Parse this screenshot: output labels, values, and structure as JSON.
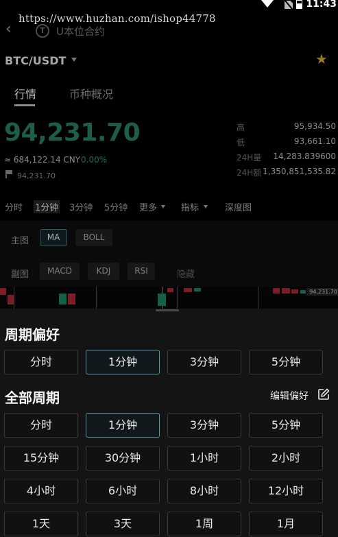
{
  "status_bar": {
    "time": "11:43",
    "icons": [
      "signal-icon",
      "sim-icon",
      "battery-icon"
    ]
  },
  "watermark": "https://www.huzhan.com/ishop44778",
  "header": {
    "back_icon": "chevron-left-icon",
    "coin_badge": "T",
    "breadcrumb": "U本位合约"
  },
  "pair": {
    "symbol": "BTC/USDT",
    "favorite_color": "#9a7b25"
  },
  "tabs": [
    {
      "label": "行情",
      "active": true
    },
    {
      "label": "币种概况",
      "active": false
    }
  ],
  "ticker": {
    "last_price": "94,231.70",
    "cny_value": "≈ 684,122.14 CNY",
    "change_pct": "0.00%",
    "mark_price": "94,231.70",
    "price_color": "#1c5e48"
  },
  "stats": [
    {
      "label": "高",
      "value": "95,934.50"
    },
    {
      "label": "低",
      "value": "93,661.10"
    },
    {
      "label": "24H量",
      "value": "14,283.839600"
    },
    {
      "label": "24H额",
      "value": "1,350,851,535.82"
    }
  ],
  "chart_toolbar": {
    "periods": [
      "分时",
      "1分钟",
      "3分钟",
      "5分钟"
    ],
    "active_period": "1分钟",
    "more": "更多",
    "indicators": "指标",
    "depth": "深度图"
  },
  "indicator_panel": {
    "main_label": "主图",
    "main_options": [
      "MA",
      "BOLL"
    ],
    "main_selected": "MA",
    "sub_label": "副图",
    "sub_options": [
      "MACD",
      "KDJ",
      "RSI"
    ],
    "hide": "隐藏"
  },
  "chart_price_tag": "94,231.70",
  "sheet": {
    "preferred_title": "周期偏好",
    "preferred": [
      "分时",
      "1分钟",
      "3分钟",
      "5分钟"
    ],
    "all_title": "全部周期",
    "edit_label": "编辑偏好",
    "edit_icon": "edit-icon",
    "all_periods": [
      [
        "分时",
        "1分钟",
        "3分钟",
        "5分钟"
      ],
      [
        "15分钟",
        "30分钟",
        "1小时",
        "2小时"
      ],
      [
        "4小时",
        "6小时",
        "8小时",
        "12小时"
      ],
      [
        "1天",
        "3天",
        "1周",
        "1月"
      ]
    ],
    "selected": "1分钟",
    "accent_color": "#5a98a6"
  }
}
